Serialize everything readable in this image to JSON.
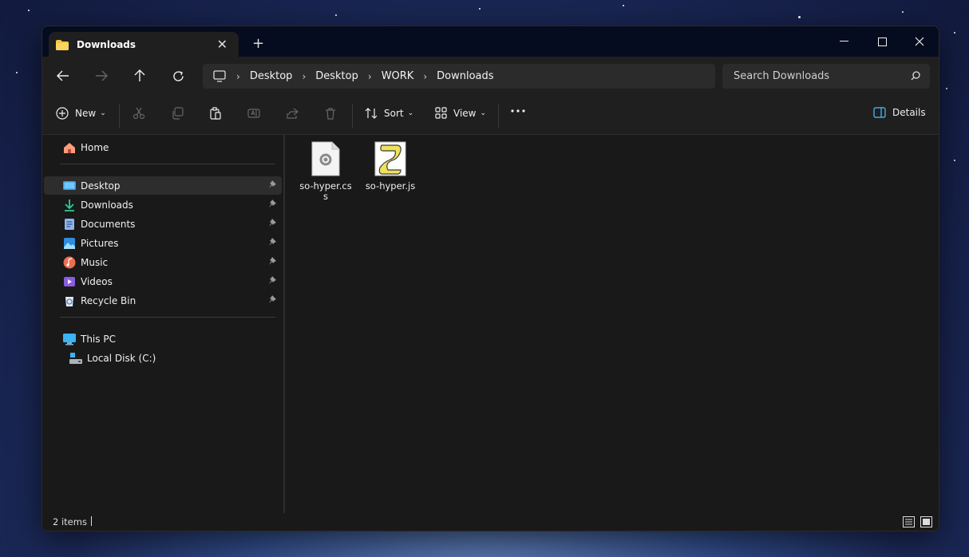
{
  "window": {
    "tab_title": "Downloads",
    "new_tab": "+"
  },
  "breadcrumb": [
    "Desktop",
    "Desktop",
    "WORK",
    "Downloads"
  ],
  "search": {
    "placeholder": "Search Downloads"
  },
  "toolbar": {
    "new_label": "New",
    "sort_label": "Sort",
    "view_label": "View",
    "details_label": "Details"
  },
  "sidebar": {
    "home": "Home",
    "quick": [
      {
        "label": "Desktop",
        "icon": "desktop-icon",
        "selected": true
      },
      {
        "label": "Downloads",
        "icon": "download-arrow-icon"
      },
      {
        "label": "Documents",
        "icon": "documents-icon"
      },
      {
        "label": "Pictures",
        "icon": "pictures-icon"
      },
      {
        "label": "Music",
        "icon": "music-icon"
      },
      {
        "label": "Videos",
        "icon": "videos-icon"
      },
      {
        "label": "Recycle Bin",
        "icon": "recycle-bin-icon"
      }
    ],
    "this_pc": "This PC",
    "local_disk": "Local Disk (C:)"
  },
  "files": [
    {
      "name": "so-hyper.css",
      "icon": "css-file-icon"
    },
    {
      "name": "so-hyper.js",
      "icon": "js-script-icon"
    }
  ],
  "status": {
    "count": "2 items"
  },
  "colors": {
    "accent": "#4cc2ff",
    "folder": "#f5c542",
    "bg": "#191919",
    "panel": "#1f1f1f"
  }
}
